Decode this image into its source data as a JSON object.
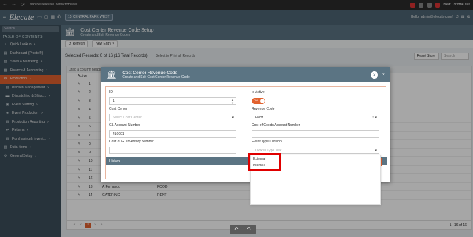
{
  "browser": {
    "url": "sap.betaelevate.net/Window/#0",
    "new_version": "New Chrome ava"
  },
  "app": {
    "logo": "Elecate",
    "location": "15 CENTRAL PARK WEST",
    "user": "Hello, admin@elecate.com!"
  },
  "sidebar": {
    "search_placeholder": "Search",
    "toc": "TABLE OF CONTENTS",
    "items": [
      {
        "label": "Quick Lookup",
        "icon": "search-icon"
      },
      {
        "label": "Dashboard (Presto®)",
        "icon": "dashboard-icon"
      },
      {
        "label": "Sales & Marketing",
        "icon": "sales-icon"
      },
      {
        "label": "Finance & Accounting",
        "icon": "finance-icon"
      },
      {
        "label": "Production",
        "icon": "production-icon"
      },
      {
        "label": "Kitchen Management",
        "icon": "kitchen-icon"
      },
      {
        "label": "Dispatching & Shipp...",
        "icon": "truck-icon"
      },
      {
        "label": "Event Staffing",
        "icon": "staff-icon"
      },
      {
        "label": "Event Production",
        "icon": "event-icon"
      },
      {
        "label": "Production Reporting",
        "icon": "report-icon"
      },
      {
        "label": "Returns",
        "icon": "return-icon"
      },
      {
        "label": "Purchasing & Invent...",
        "icon": "cart-icon"
      },
      {
        "label": "Data Items",
        "icon": "data-icon"
      },
      {
        "label": "General Setup",
        "icon": "gear-icon"
      }
    ]
  },
  "page": {
    "title": "Cost Center Revenue Code Setup",
    "subtitle": "Create and Edit Revenue Codes",
    "toolbar": {
      "refresh": "Refresh",
      "new_entry": "New Entry"
    },
    "selected_records": "Selected Records: 0 of 16 (16 Total Records)",
    "select_to_print": "Select to Print all Records",
    "reset_btn": "Reset Store",
    "search_placeholder": "Search",
    "grid_hint": "Drag a column header here",
    "grid_header": {
      "action": "Active"
    },
    "rows": [
      {
        "no": "1",
        "name": "",
        "code": "",
        "gl": "",
        "cogs": ""
      },
      {
        "no": "2",
        "name": "",
        "code": "",
        "gl": "",
        "cogs": ""
      },
      {
        "no": "3",
        "name": "",
        "code": "",
        "gl": "",
        "cogs": ""
      },
      {
        "no": "4",
        "name": "",
        "code": "",
        "gl": "",
        "cogs": ""
      },
      {
        "no": "5",
        "name": "",
        "code": "",
        "gl": "",
        "cogs": ""
      },
      {
        "no": "6",
        "name": "",
        "code": "",
        "gl": "",
        "cogs": ""
      },
      {
        "no": "7",
        "name": "",
        "code": "",
        "gl": "",
        "cogs": ""
      },
      {
        "no": "8",
        "name": "",
        "code": "",
        "gl": "",
        "cogs": ""
      },
      {
        "no": "9",
        "name": "",
        "code": "",
        "gl": "",
        "cogs": ""
      },
      {
        "no": "10",
        "name": "",
        "code": "",
        "gl": "",
        "cogs": ""
      },
      {
        "no": "11",
        "name": "",
        "code": "",
        "gl": "",
        "cogs": ""
      },
      {
        "no": "12",
        "name": "The Wallace",
        "code": "EQUIP",
        "gl": "5254",
        "cogs": "3000"
      },
      {
        "no": "13",
        "name": "A Fernando",
        "code": "FOOD",
        "gl": "",
        "cogs": ""
      },
      {
        "no": "14",
        "name": "CATERING",
        "code": "RENT",
        "gl": "",
        "cogs": ""
      }
    ],
    "pager": {
      "current": "1",
      "info": "1 - 16 of 16"
    }
  },
  "modal": {
    "title": "Cost Center Revenue Code",
    "subtitle": "Create and Edit Cost Center Revenue Code",
    "help": "?",
    "close": "×",
    "fields": {
      "id_label": "ID",
      "id_value": "1",
      "is_active_label": "Is Active",
      "is_active_on": "ON",
      "cost_center_label": "Cost Center",
      "cost_center_placeholder": "Select Cost Center",
      "revenue_code_label": "Revenue Code",
      "revenue_code_value": "Food",
      "gl_account_label": "GL Account Number",
      "gl_account_value": "410001",
      "cogs_label": "Cost of Goods Account Number",
      "cogs_value": "",
      "cost_gl_inv_label": "Cost of GL Inventory Number",
      "cost_gl_inv_value": "",
      "event_type_label": "Event Type Division",
      "event_type_placeholder": "Look in Type Nex"
    },
    "history_label": "History",
    "dropdown_options": [
      "External",
      "Internal"
    ]
  }
}
